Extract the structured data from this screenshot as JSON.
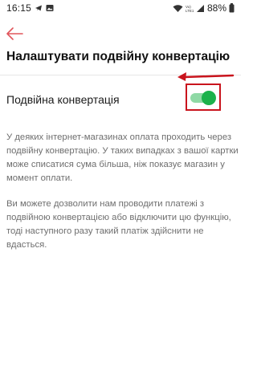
{
  "status_bar": {
    "time": "16:15",
    "battery": "88%",
    "network_label": "VoLTE"
  },
  "colors": {
    "accent_back": "#e0565c",
    "toggle_on": "#1bb24b",
    "toggle_track": "#8fd9a5",
    "annotation": "#c9141d"
  },
  "header": {
    "title": "Налаштувати подвійну конвертацію"
  },
  "setting": {
    "label": "Подвійна конвертація",
    "enabled": true
  },
  "description": {
    "paragraph_1": "У деяких інтернет-магазинах оплата проходить через подвійну конвертацію. У таких випадках з вашої картки може списатися сума більша, ніж показує магазин у момент оплати.",
    "paragraph_2": "Ви можете дозволити нам проводити платежі з подвійною конвертацією або відключити цю функцію, тоді наступного разу такий платіж здійснити не вдасться."
  }
}
